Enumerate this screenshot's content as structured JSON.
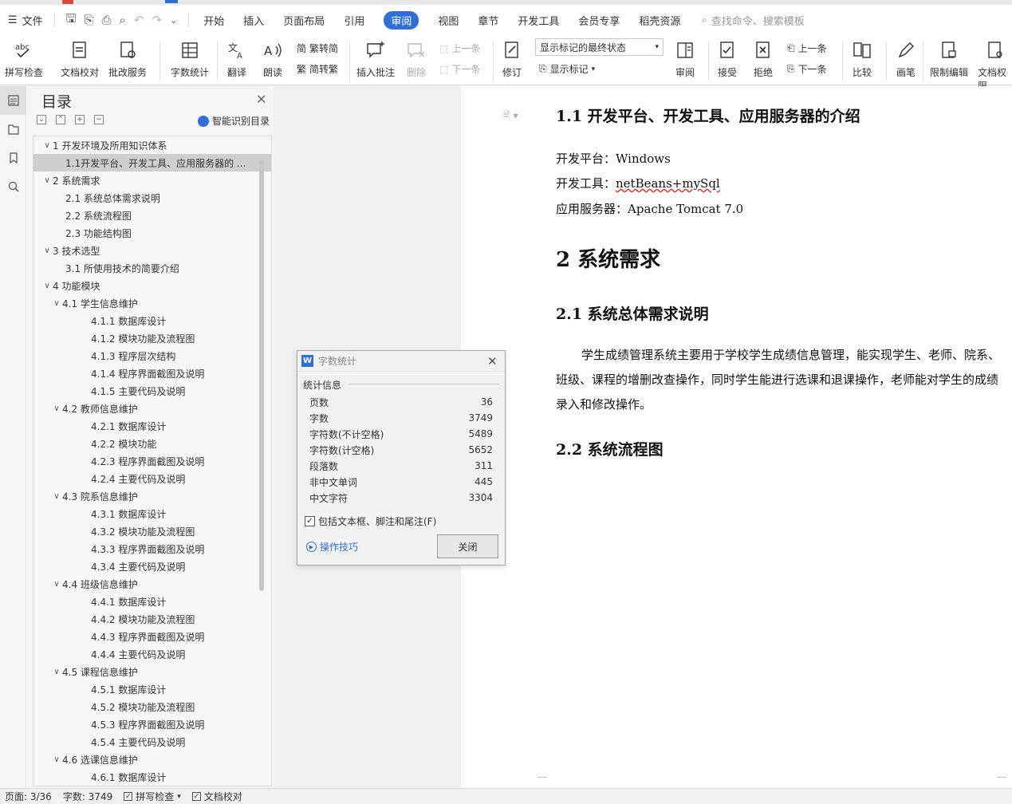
{
  "menubar": {
    "file_label": "文件",
    "tabs": [
      "开始",
      "插入",
      "页面布局",
      "引用",
      "审阅",
      "视图",
      "章节",
      "开发工具",
      "会员专享",
      "稻壳资源"
    ],
    "active_tab": "审阅",
    "search_placeholder": "查找命令、搜索模板"
  },
  "ribbon": {
    "spellcheck": "拼写检查",
    "proofread": "文档校对",
    "correction": "批改服务",
    "wordcount": "字数统计",
    "translate": "翻译",
    "read_aloud": "朗读",
    "trad_to_simp": "繁转简",
    "simp_to_trad": "简转繁",
    "insert_comment": "插入批注",
    "delete": "删除",
    "prev": "上一条",
    "next": "下一条",
    "track_changes": "修订",
    "markup_select": "显示标记的最终状态",
    "show_markup": "显示标记",
    "review": "审阅",
    "accept": "接受",
    "reject": "拒绝",
    "prev2": "上一条",
    "next2": "下一条",
    "compare": "比较",
    "ink": "画笔",
    "restrict": "限制编辑",
    "doc_permission": "文档权限"
  },
  "toc": {
    "title": "目录",
    "ai_label": "智能识别目录",
    "items": [
      {
        "level": "l1",
        "arrow": "∨",
        "text": "1  开发环境及所用知识体系"
      },
      {
        "level": "l2",
        "arrow": "",
        "text": "1.1开发平台、开发工具、应用服务器的 ...",
        "selected": true
      },
      {
        "level": "l1",
        "arrow": "∨",
        "text": "2  系统需求"
      },
      {
        "level": "l2",
        "arrow": "",
        "text": "2.1  系统总体需求说明"
      },
      {
        "level": "l2",
        "arrow": "",
        "text": "2.2  系统流程图"
      },
      {
        "level": "l2",
        "arrow": "",
        "text": "2.3  功能结构图"
      },
      {
        "level": "l1",
        "arrow": "∨",
        "text": "3  技术选型"
      },
      {
        "level": "l2",
        "arrow": "",
        "text": "3.1  所使用技术的简要介绍"
      },
      {
        "level": "l1",
        "arrow": "∨",
        "text": "4  功能模块"
      },
      {
        "level": "l2s",
        "arrow": "∨",
        "text": "4.1  学生信息维护"
      },
      {
        "level": "l3",
        "arrow": "",
        "text": "4.1.1  数据库设计"
      },
      {
        "level": "l3",
        "arrow": "",
        "text": "4.1.2  模块功能及流程图"
      },
      {
        "level": "l3",
        "arrow": "",
        "text": "4.1.3  程序层次结构"
      },
      {
        "level": "l3",
        "arrow": "",
        "text": "4.1.4  程序界面截图及说明"
      },
      {
        "level": "l3",
        "arrow": "",
        "text": "4.1.5  主要代码及说明"
      },
      {
        "level": "l2s",
        "arrow": "∨",
        "text": "4.2  教师信息维护"
      },
      {
        "level": "l3",
        "arrow": "",
        "text": "4.2.1  数据库设计"
      },
      {
        "level": "l3",
        "arrow": "",
        "text": "4.2.2  模块功能"
      },
      {
        "level": "l3",
        "arrow": "",
        "text": "4.2.3  程序界面截图及说明"
      },
      {
        "level": "l3",
        "arrow": "",
        "text": "4.2.4  主要代码及说明"
      },
      {
        "level": "l2s",
        "arrow": "∨",
        "text": "4.3  院系信息维护"
      },
      {
        "level": "l3",
        "arrow": "",
        "text": "4.3.1  数据库设计"
      },
      {
        "level": "l3",
        "arrow": "",
        "text": "4.3.2 模块功能及流程图"
      },
      {
        "level": "l3",
        "arrow": "",
        "text": "4.3.3  程序界面截图及说明"
      },
      {
        "level": "l3",
        "arrow": "",
        "text": "4.3.4 主要代码及说明"
      },
      {
        "level": "l2s",
        "arrow": "∨",
        "text": "4.4  班级信息维护"
      },
      {
        "level": "l3",
        "arrow": "",
        "text": "4.4.1  数据库设计"
      },
      {
        "level": "l3",
        "arrow": "",
        "text": "4.4.2  模块功能及流程图"
      },
      {
        "level": "l3",
        "arrow": "",
        "text": "4.4.3 程序界面截图及说明"
      },
      {
        "level": "l3",
        "arrow": "",
        "text": "4.4.4 主要代码及说明"
      },
      {
        "level": "l2s",
        "arrow": "∨",
        "text": "4.5  课程信息维护"
      },
      {
        "level": "l3",
        "arrow": "",
        "text": "4.5.1  数据库设计"
      },
      {
        "level": "l3",
        "arrow": "",
        "text": "4.5.2  模块功能及流程图"
      },
      {
        "level": "l3",
        "arrow": "",
        "text": "4.5.3 程序界面截图及说明"
      },
      {
        "level": "l3",
        "arrow": "",
        "text": "4.5.4 主要代码及说明"
      },
      {
        "level": "l2s",
        "arrow": "∨",
        "text": "4.6  选课信息维护"
      },
      {
        "level": "l3",
        "arrow": "",
        "text": "4.6.1  数据库设计"
      }
    ]
  },
  "document": {
    "h_1_1": "1.1  开发平台、开发工具、应用服务器的介绍",
    "platform_label": "开发平台：",
    "platform_value": "Windows",
    "tools_label": "开发工具：",
    "tools_value": "netBeans+mySql",
    "server_label": "应用服务器：",
    "server_value": "Apache Tomcat 7.0",
    "h_2": "2  系统需求",
    "h_2_1": "2.1  系统总体需求说明",
    "para_2_1": "学生成绩管理系统主要用于学校学生成绩信息管理，能实现学生、老师、院系、班级、课程的增删改查操作，同时学生能进行选课和退课操作，老师能对学生的成绩录入和修改操作。",
    "h_2_2": "2.2  系统流程图"
  },
  "dialog": {
    "title": "字数统计",
    "section": "统计信息",
    "stats": [
      {
        "label": "页数",
        "value": "36"
      },
      {
        "label": "字数",
        "value": "3749"
      },
      {
        "label": "字符数(不计空格)",
        "value": "5489"
      },
      {
        "label": "字符数(计空格)",
        "value": "5652"
      },
      {
        "label": "段落数",
        "value": "311"
      },
      {
        "label": "非中文单词",
        "value": "445"
      },
      {
        "label": "中文字符",
        "value": "3304"
      }
    ],
    "include_label": "包括文本框、脚注和尾注(F)",
    "tips_label": "操作技巧",
    "close_label": "关闭"
  },
  "status": {
    "page": "页面: 3/36",
    "words": "字数: 3749",
    "spell": "拼写检查",
    "proof": "文档校对"
  },
  "colors": {
    "accent": "#2f6fd6",
    "selected_toc": "#cfcfcf",
    "panel_bg": "#f5f5f5"
  }
}
